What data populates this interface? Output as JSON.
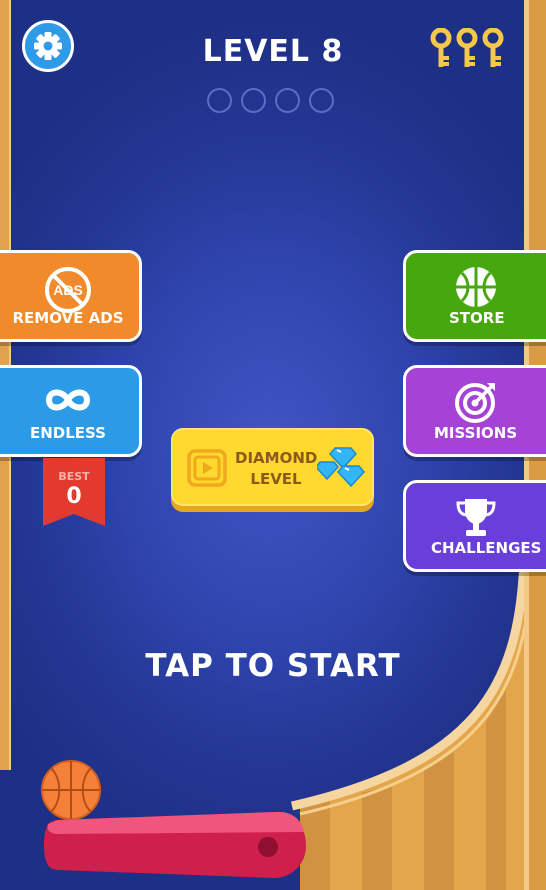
{
  "header": {
    "level_title": "LEVEL 8",
    "progress_slots_total": 4,
    "progress_slots_filled": 0,
    "keys_count": 3
  },
  "buttons": {
    "remove_ads": "REMOVE ADS",
    "endless": "ENDLESS",
    "store": "STORE",
    "missions": "MISSIONS",
    "challenges": "CHALLENGES"
  },
  "best": {
    "label": "BEST",
    "value": "0"
  },
  "diamond_level": {
    "line1": "DIAMOND",
    "line2": "LEVEL"
  },
  "ads_icon_text": "ADS",
  "prompt": "TAP TO START",
  "colors": {
    "remove_ads": "#f08a2a",
    "endless": "#2b9be8",
    "store": "#46a80e",
    "missions": "#a543d6",
    "challenges": "#6a3fd9",
    "best_ribbon": "#e23a2e",
    "diamond_button": "#ffd92e",
    "flipper": "#e0315c",
    "ball": "#f5803a"
  },
  "icons": {
    "settings": "gear-icon",
    "keys": "key-icon",
    "remove_ads": "no-ads-icon",
    "endless": "infinity-icon",
    "store": "basketball-icon",
    "missions": "target-icon",
    "challenges": "trophy-icon",
    "diamond_video": "video-play-icon",
    "diamonds": "diamond-icon"
  }
}
